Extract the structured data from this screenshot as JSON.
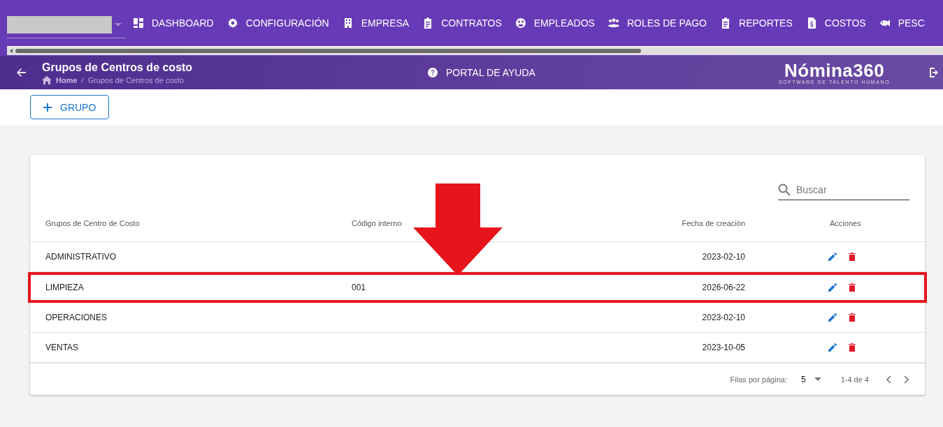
{
  "nav": {
    "items": [
      {
        "label": "DASHBOARD"
      },
      {
        "label": "CONFIGURACIÓN"
      },
      {
        "label": "EMPRESA"
      },
      {
        "label": "CONTRATOS"
      },
      {
        "label": "EMPLEADOS"
      },
      {
        "label": "ROLES DE PAGO"
      },
      {
        "label": "REPORTES"
      },
      {
        "label": "COSTOS"
      },
      {
        "label": "PESC"
      }
    ]
  },
  "header": {
    "title": "Grupos de Centros de costo",
    "breadcrumb": [
      "Home",
      "Grupos de Centros de costo"
    ],
    "breadcrumb_separator": "/",
    "help": "PORTAL DE AYUDA",
    "logo": "Nómina360",
    "logo_tagline": "SOFTWARE DE TALENTO HUMANO"
  },
  "toolbar": {
    "add_button": "GRUPO"
  },
  "table": {
    "search": {
      "placeholder": "Buscar"
    },
    "columns": [
      "Grupos de Centro de Costo",
      "Código interno",
      "Fecha de creación",
      "Acciones"
    ],
    "rows": [
      {
        "name": "ADMINISTRATIVO",
        "code": "",
        "date": "2023-02-10",
        "highlighted": false
      },
      {
        "name": "LIMPIEZA",
        "code": "001",
        "date": "2026-06-22",
        "highlighted": true
      },
      {
        "name": "OPERACIONES",
        "code": "",
        "date": "2023-02-10",
        "highlighted": false
      },
      {
        "name": "VENTAS",
        "code": "",
        "date": "2023-10-05",
        "highlighted": false
      }
    ],
    "footer": {
      "rows_label": "Filas por página:",
      "rows_value": "5",
      "range": "1-4 de 4"
    }
  }
}
